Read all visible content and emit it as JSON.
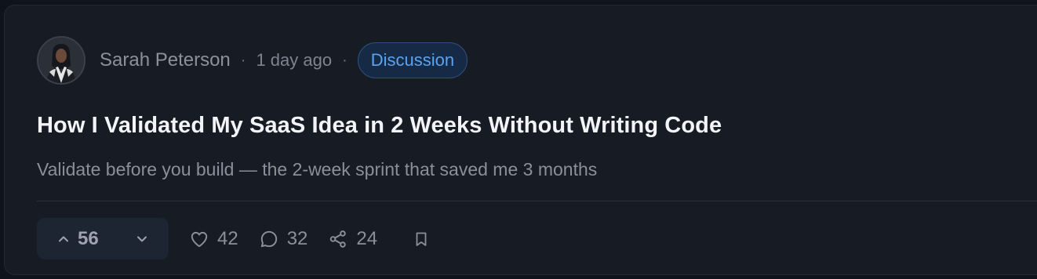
{
  "post": {
    "author": "Sarah Peterson",
    "separator": "·",
    "time": "1 day ago",
    "tag": "Discussion",
    "title": "How I Validated My SaaS Idea in 2 Weeks Without Writing Code",
    "subtitle": "Validate before you build — the 2-week sprint that saved me 3 months"
  },
  "actions": {
    "votes": "56",
    "likes": "42",
    "comments": "32",
    "shares": "24"
  },
  "icons": {
    "upvote": "chevron-up-icon",
    "downvote": "chevron-down-icon",
    "like": "heart-icon",
    "comment": "comment-icon",
    "share": "share-icon",
    "bookmark": "bookmark-icon"
  },
  "colors": {
    "background": "#171b23",
    "accent": "#5aa3f0",
    "badge_bg": "#172a45"
  }
}
